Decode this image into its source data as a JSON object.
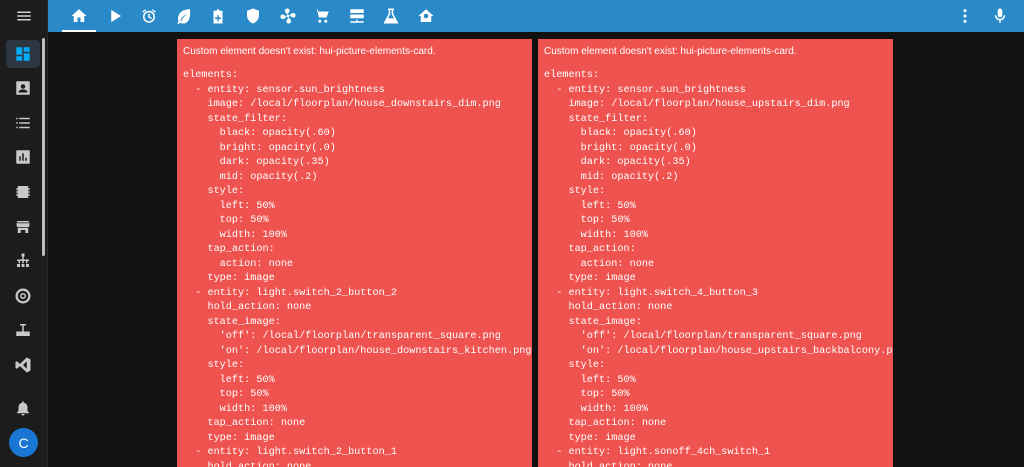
{
  "sidebar": {
    "items": [
      {
        "name": "overview",
        "icon": "dashboard-icon",
        "active": true
      },
      {
        "name": "logbook",
        "icon": "account-box-icon",
        "active": false
      },
      {
        "name": "list",
        "icon": "format-list-icon",
        "active": false
      },
      {
        "name": "history",
        "icon": "chart-box-icon",
        "active": false
      },
      {
        "name": "energy",
        "icon": "server-chip-icon",
        "active": false
      },
      {
        "name": "store",
        "icon": "store-icon",
        "active": false
      },
      {
        "name": "network",
        "icon": "sitemap-icon",
        "active": false
      },
      {
        "name": "media",
        "icon": "target-icon",
        "active": false
      },
      {
        "name": "router",
        "icon": "router-icon",
        "active": false
      },
      {
        "name": "vscode",
        "icon": "vscode-icon",
        "active": false
      }
    ],
    "notifications_icon": "bell-icon",
    "user_initial": "C"
  },
  "topbar": {
    "tabs": [
      {
        "name": "home",
        "icon": "home-icon",
        "active": true
      },
      {
        "name": "media",
        "icon": "play-icon",
        "active": false
      },
      {
        "name": "alarm",
        "icon": "alarm-icon",
        "active": false
      },
      {
        "name": "leaf",
        "icon": "leaf-icon",
        "active": false
      },
      {
        "name": "home-plus",
        "icon": "home-plus-icon",
        "active": false
      },
      {
        "name": "security",
        "icon": "shield-icon",
        "active": false
      },
      {
        "name": "fan",
        "icon": "fan-icon",
        "active": false
      },
      {
        "name": "cart",
        "icon": "cart-icon",
        "active": false
      },
      {
        "name": "server",
        "icon": "server-icon",
        "active": false
      },
      {
        "name": "flask",
        "icon": "flask-icon",
        "active": false
      },
      {
        "name": "home-alt",
        "icon": "home-alt-icon",
        "active": false
      }
    ],
    "more_icon": "dots-vertical-icon",
    "mic_icon": "microphone-icon",
    "accent": "#2a8ac9"
  },
  "cards": [
    {
      "error_title": "Custom element doesn't exist: hui-picture-elements-card.",
      "code": "elements:\n  - entity: sensor.sun_brightness\n    image: /local/floorplan/house_downstairs_dim.png\n    state_filter:\n      black: opacity(.60)\n      bright: opacity(.0)\n      dark: opacity(.35)\n      mid: opacity(.2)\n    style:\n      left: 50%\n      top: 50%\n      width: 100%\n    tap_action:\n      action: none\n    type: image\n  - entity: light.switch_2_button_2\n    hold_action: none\n    state_image:\n      'off': /local/floorplan/transparent_square.png\n      'on': /local/floorplan/house_downstairs_kitchen.png\n    style:\n      left: 50%\n      top: 50%\n      width: 100%\n    tap_action: none\n    type: image\n  - entity: light.switch_2_button_1\n    hold_action: none"
    },
    {
      "error_title": "Custom element doesn't exist: hui-picture-elements-card.",
      "code": "elements:\n  - entity: sensor.sun_brightness\n    image: /local/floorplan/house_upstairs_dim.png\n    state_filter:\n      black: opacity(.60)\n      bright: opacity(.0)\n      dark: opacity(.35)\n      mid: opacity(.2)\n    style:\n      left: 50%\n      top: 50%\n      width: 100%\n    tap_action:\n      action: none\n    type: image\n  - entity: light.switch_4_button_3\n    hold_action: none\n    state_image:\n      'off': /local/floorplan/transparent_square.png\n      'on': /local/floorplan/house_upstairs_backbalcony.png\n    style:\n      left: 50%\n      top: 50%\n      width: 100%\n    tap_action: none\n    type: image\n  - entity: light.sonoff_4ch_switch_1\n    hold_action: none"
    }
  ],
  "colors": {
    "error_card": "#ef5350",
    "background": "#111111",
    "sidebar": "#1c1c1c",
    "active_icon": "#03a9f4"
  }
}
